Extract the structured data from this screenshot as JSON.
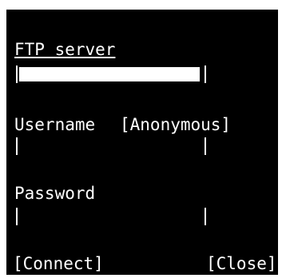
{
  "server": {
    "label": "FTP server",
    "value": "",
    "placeholder": ""
  },
  "username": {
    "label": "Username",
    "default_action": "[Anonymous]",
    "value": "",
    "placeholder": ""
  },
  "password": {
    "label": "Password",
    "value": "",
    "placeholder": ""
  },
  "buttons": {
    "connect": "[Connect]",
    "close": "[Close]"
  },
  "colors": {
    "background": "#000000",
    "foreground": "#ffffff",
    "frame": "#ffffff"
  }
}
